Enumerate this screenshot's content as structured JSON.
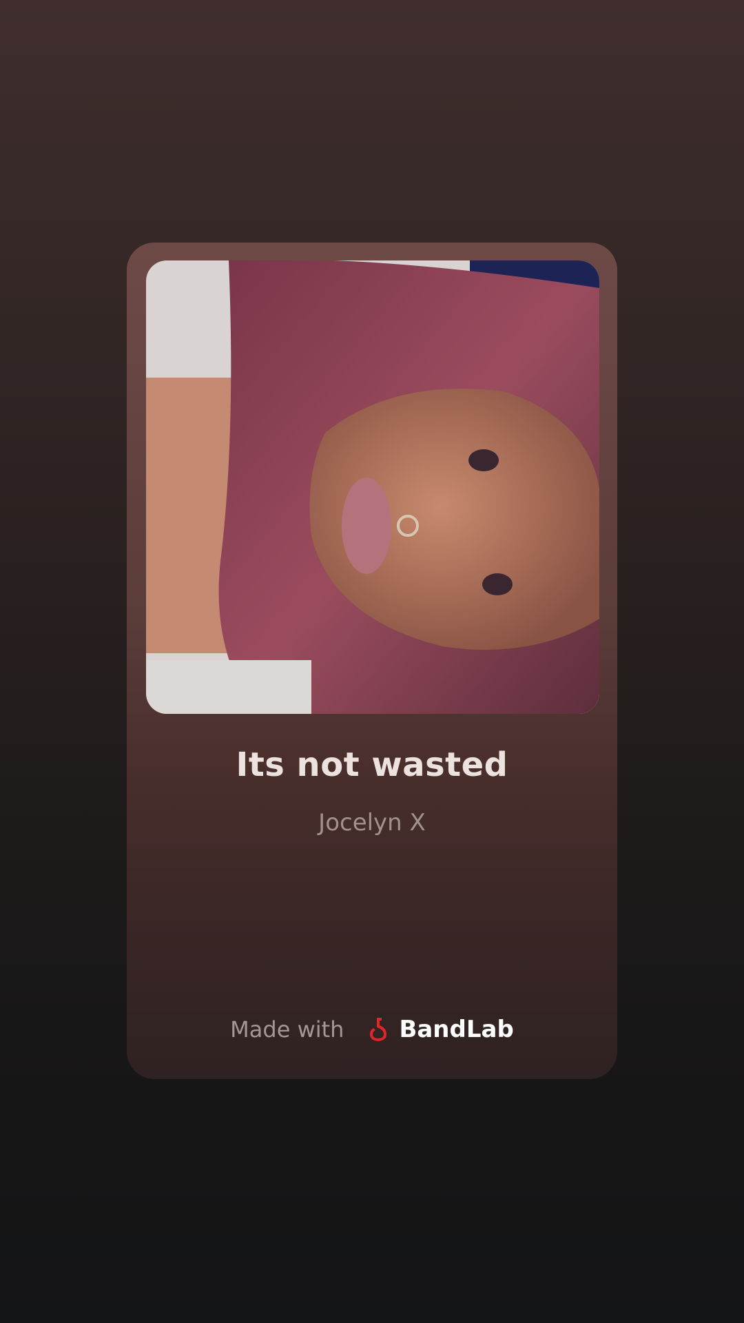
{
  "track": {
    "title": "Its not wasted",
    "artist": "Jocelyn X"
  },
  "artwork": {
    "icon": "portrait-image"
  },
  "footer": {
    "made_with": "Made with",
    "brand_name": "BandLab",
    "brand_icon": "bandlab-logo-icon"
  },
  "colors": {
    "brand_red": "#e3242b",
    "title_text": "#ece3de",
    "artist_text": "#a3918c"
  }
}
